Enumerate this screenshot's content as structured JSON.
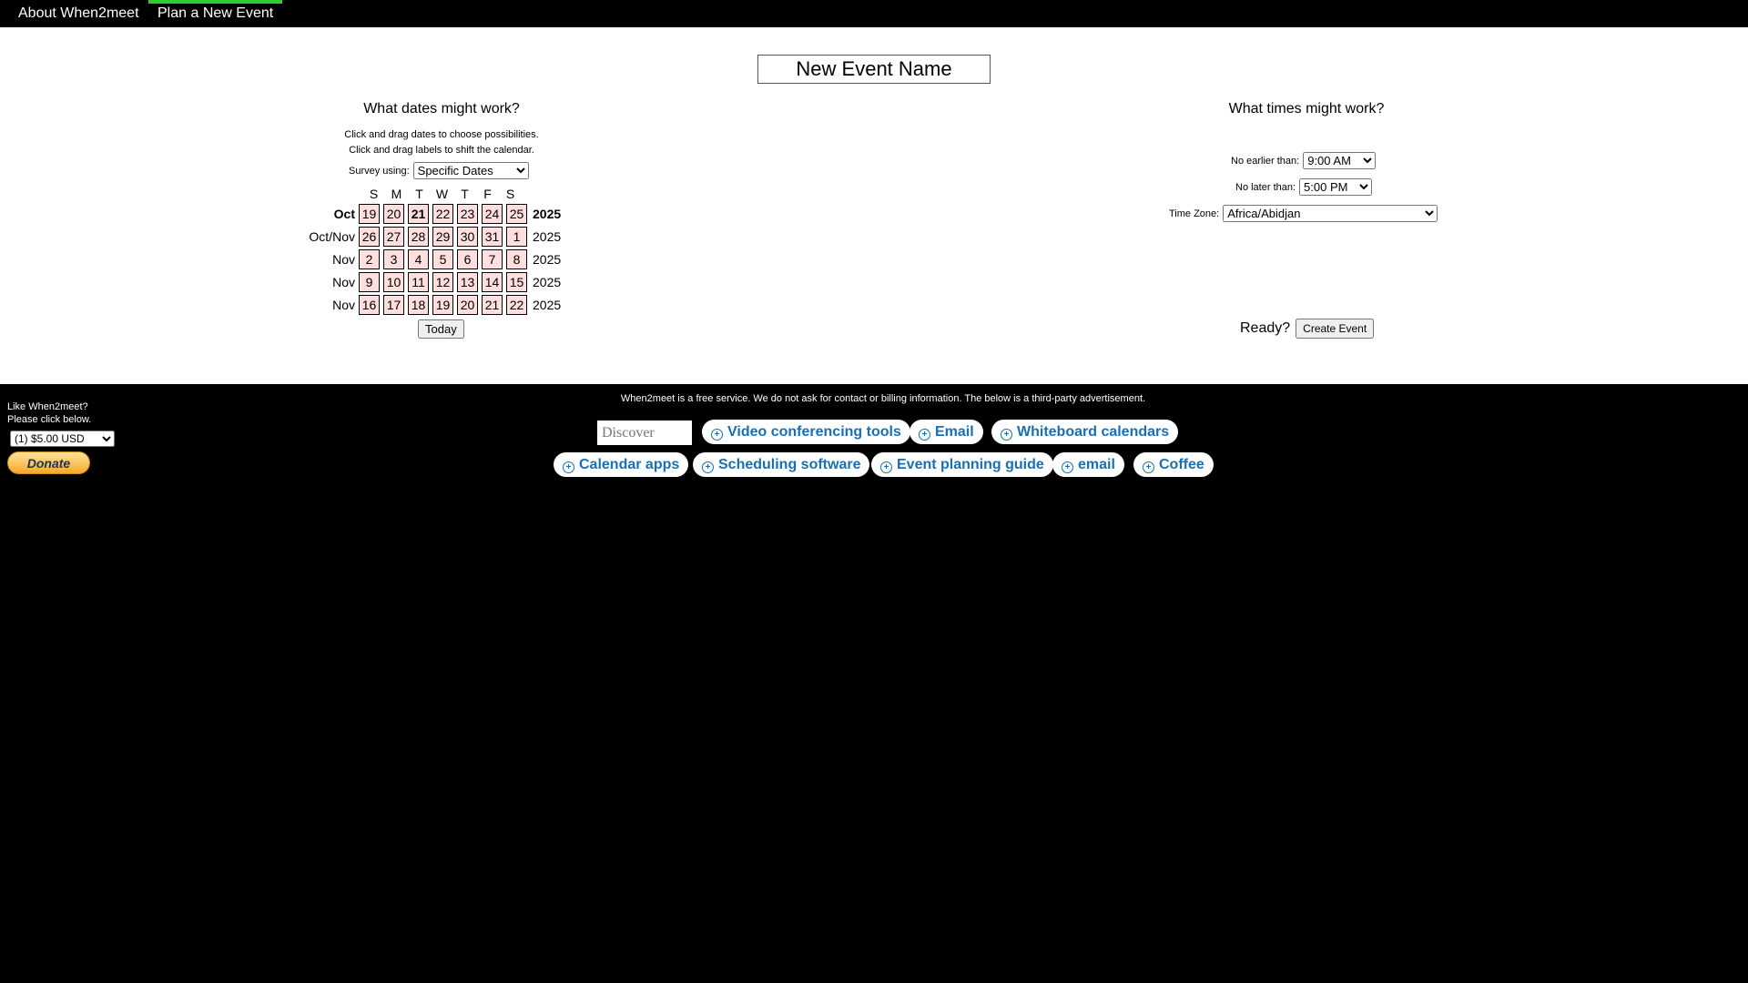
{
  "nav": {
    "about": "About When2meet",
    "plan": "Plan a New Event"
  },
  "event": {
    "name": "New Event Name"
  },
  "dates": {
    "heading": "What dates might work?",
    "instruction1": "Click and drag dates to choose possibilities.",
    "instruction2": "Click and drag labels to shift the calendar.",
    "survey_label": "Survey using:",
    "survey_value": "Specific Dates",
    "dow": [
      "S",
      "M",
      "T",
      "W",
      "T",
      "F",
      "S"
    ],
    "weeks": [
      {
        "month": "Oct",
        "days": [
          "19",
          "20",
          "21",
          "22",
          "23",
          "24",
          "25"
        ],
        "year": "2025"
      },
      {
        "month": "Oct/Nov",
        "days": [
          "26",
          "27",
          "28",
          "29",
          "30",
          "31",
          "1"
        ],
        "year": "2025"
      },
      {
        "month": "Nov",
        "days": [
          "2",
          "3",
          "4",
          "5",
          "6",
          "7",
          "8"
        ],
        "year": "2025"
      },
      {
        "month": "Nov",
        "days": [
          "9",
          "10",
          "11",
          "12",
          "13",
          "14",
          "15"
        ],
        "year": "2025"
      },
      {
        "month": "Nov",
        "days": [
          "16",
          "17",
          "18",
          "19",
          "20",
          "21",
          "22"
        ],
        "year": "2025"
      }
    ],
    "today_button": "Today"
  },
  "times": {
    "heading": "What times might work?",
    "earliest_label": "No earlier than:",
    "earliest_value": "9:00 AM",
    "latest_label": "No later than:",
    "latest_value": "5:00 PM",
    "timezone_label": "Time Zone:",
    "timezone_value": "Africa/Abidjan",
    "ready_label": "Ready?",
    "create_button": "Create Event"
  },
  "footer": {
    "like_text": "Like When2meet?",
    "click_text": "Please click below.",
    "amount": "(1) $5.00 USD",
    "donate": "Donate",
    "disclaimer": "When2meet is a free service. We do not ask for contact or billing information. The below is a third-party advertisement.",
    "discover": "Discover more",
    "pills": [
      "Video conferencing tools",
      "Email",
      "Whiteboard calendars",
      "Calendar apps",
      "Scheduling software",
      "Event planning guide",
      "email",
      "Coffee"
    ]
  },
  "colors": {
    "day_cell_bg": "#ffdede",
    "nav_active_bar": "#2ecc2e",
    "pill_text": "#1a6fb4"
  }
}
